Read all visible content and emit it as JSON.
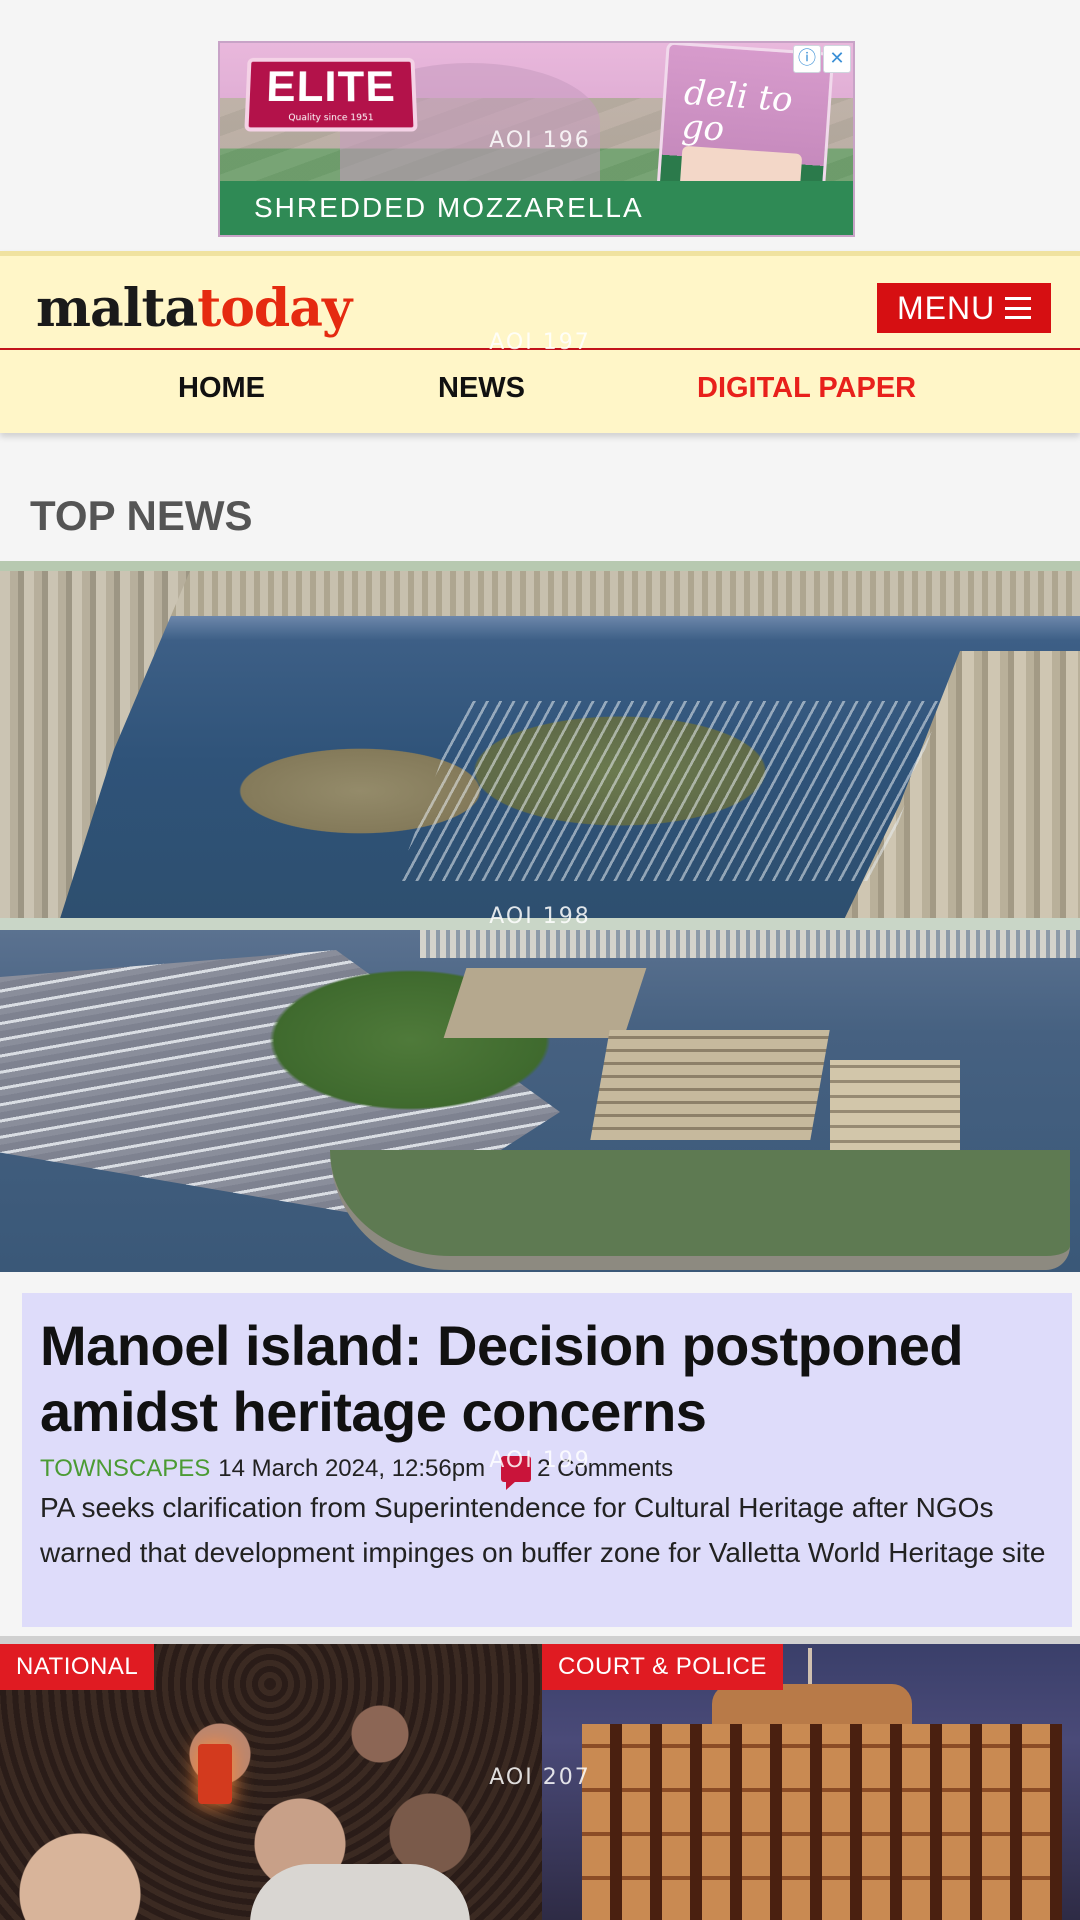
{
  "overlays": {
    "aoi_ad": "AOI 196",
    "aoi_header": "AOI 197",
    "aoi_hero": "AOI 198",
    "aoi_headline": "AOI 199",
    "aoi_tiles": "AOI 207"
  },
  "ad": {
    "brand": "ELITE",
    "tagline": "Quality since 1951",
    "product_line": "SHREDDED MOZZARELLA",
    "pack_title": "deli to go",
    "info_icon": "info-icon",
    "close_icon": "close-icon",
    "colors": {
      "background": "#e9b8dc",
      "strip": "#2f8a55",
      "logo": "#b3124a"
    }
  },
  "header": {
    "logo_part1": "malta",
    "logo_part2": "today",
    "menu_label": "MENU",
    "menu_icon": "hamburger-icon",
    "nav": [
      {
        "label": "HOME"
      },
      {
        "label": "NEWS"
      },
      {
        "label": "DIGITAL PAPER"
      }
    ],
    "colors": {
      "background": "#fff6c8",
      "accent": "#d60f12"
    }
  },
  "main": {
    "section_title": "TOP NEWS",
    "headline": "Manoel island: Decision postponed amidst heritage concerns",
    "category": "TOWNSCAPES",
    "date": "14 March 2024, 12:56pm",
    "comments": "2 Comments",
    "comment_icon": "comment-icon",
    "summary": "PA seeks clarification from Superintendence for Cultural Heritage after NGOs warned that development impinges on buffer zone for Valletta World Heritage site",
    "colors": {
      "card": "#dedcfa",
      "category": "#4b9b34"
    }
  },
  "tiles": [
    {
      "label": "NATIONAL"
    },
    {
      "label": "COURT & POLICE"
    }
  ]
}
